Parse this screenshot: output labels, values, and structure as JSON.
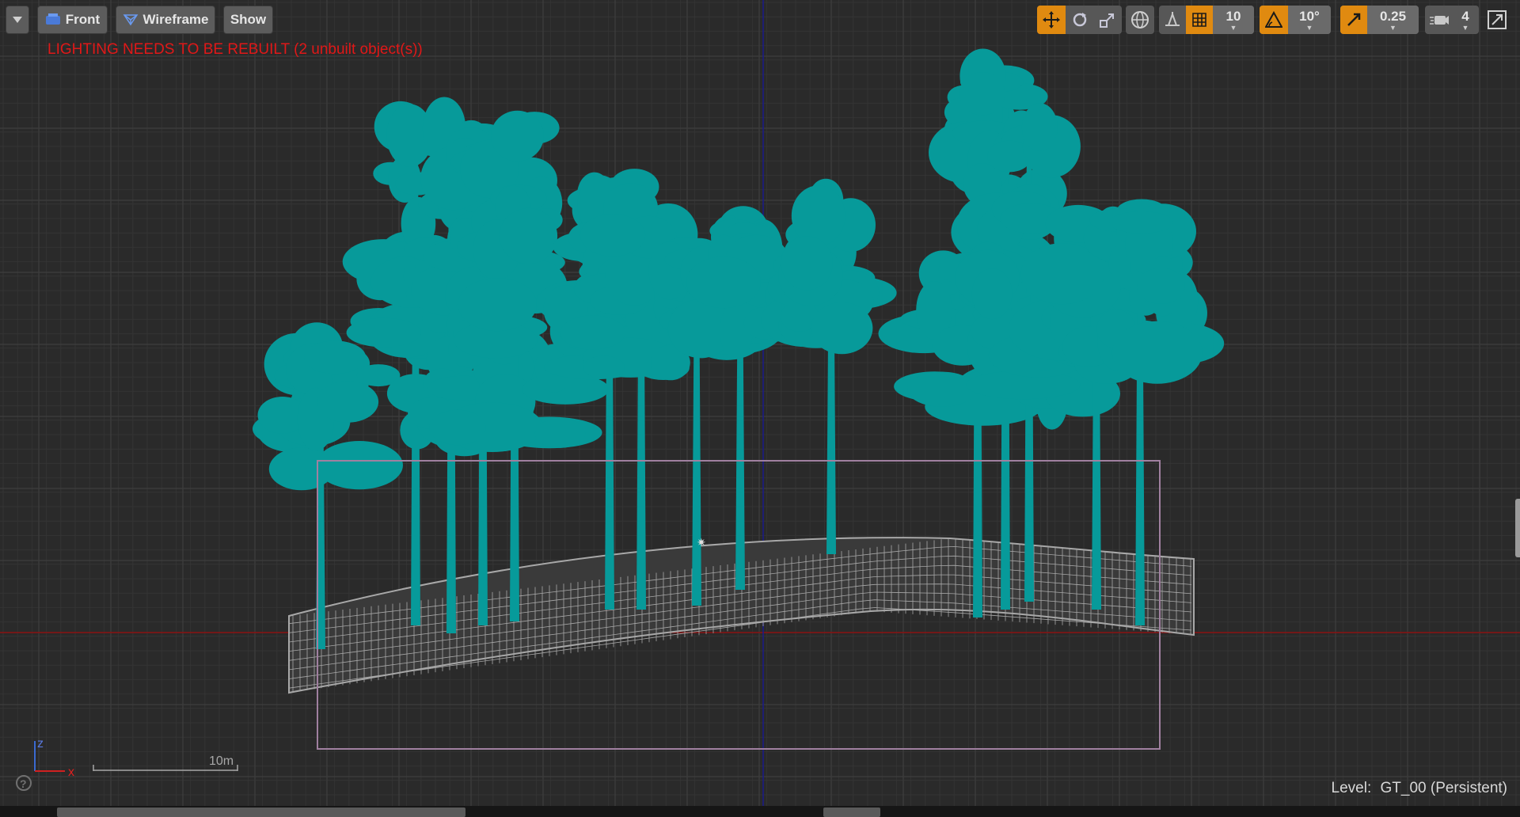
{
  "toolbar": {
    "menu_icon": "chevron-down-icon",
    "view_mode_label": "Front",
    "view_mode_icon": "front-view-icon",
    "render_mode_label": "Wireframe",
    "render_mode_icon": "wireframe-icon",
    "show_label": "Show",
    "transform_icons": [
      "translate-icon",
      "rotate-icon",
      "scale-icon"
    ],
    "world_icon": "globe-icon",
    "surface_snap_icon": "surface-snap-icon",
    "grid_snap_value": "10",
    "rotation_snap_value": "10°",
    "scale_snap_value": "0.25",
    "camera_speed_value": "4",
    "maximize_icon": "maximize-icon"
  },
  "warning": "LIGHTING NEEDS TO BE REBUILT (2 unbuilt object(s))",
  "axis_labels": {
    "z": "z",
    "x": "x"
  },
  "scale_bar_label": "10m",
  "level": {
    "label": "Level:",
    "value": "GT_00 (Persistent)"
  },
  "help_icon": "help-icon",
  "colors": {
    "foliage_wireframe": "#079a9a",
    "terrain_wireframe": "#a8a8a8",
    "background": "#2a2a2a",
    "grid_minor": "#343434",
    "grid_major": "#3e3e3e",
    "x_axis_line": "#8a1010",
    "z_axis_line": "#1a1a8a",
    "warning_text": "#e01818",
    "snap_active": "#e08a10",
    "bounds_box": "#a080a0"
  }
}
